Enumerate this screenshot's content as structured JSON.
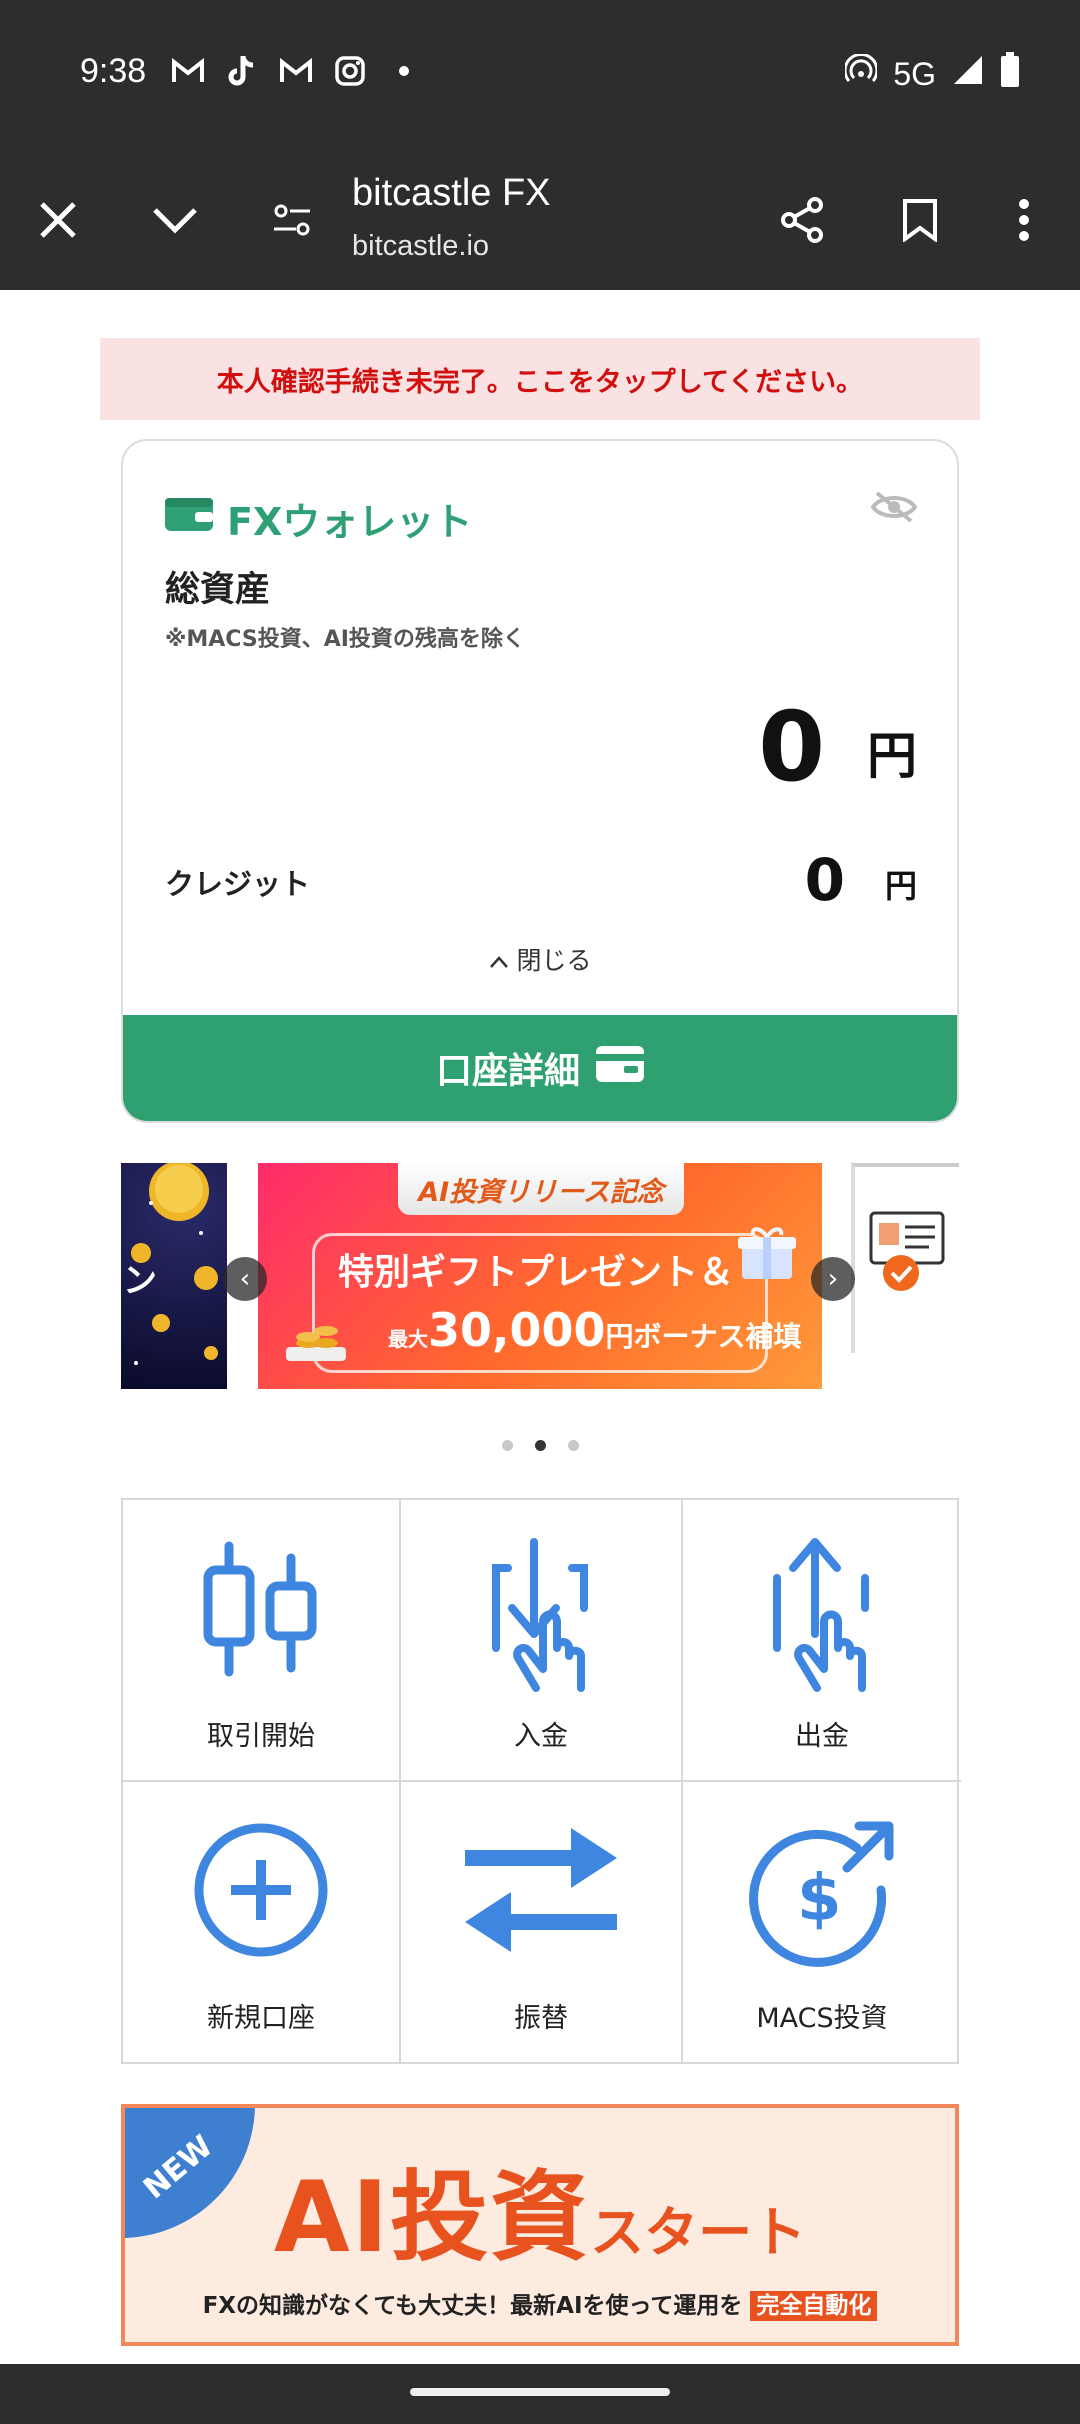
{
  "status_bar": {
    "time": "9:38",
    "network": "5G"
  },
  "browser": {
    "title": "bitcastle FX",
    "url": "bitcastle.io"
  },
  "alert": {
    "text": "本人確認手続き未完了。ここをタップしてください。"
  },
  "wallet": {
    "heading": "FXウォレット",
    "total_label": "総資産",
    "note": "※MACS投資、AI投資の残高を除く",
    "total_amount": "0",
    "currency": "円",
    "credit_label": "クレジット",
    "credit_amount": "0",
    "close_label": "閉じる",
    "detail_button": "口座詳細"
  },
  "carousel": {
    "slide_top": "AI投資リリース記念",
    "slide_line1": "特別ギフトプレゼント＆",
    "slide_line2_prefix": "最大",
    "slide_amount": "30,000",
    "slide_line2_suffix": "円ボーナス補填",
    "left_slide_text": "ン",
    "dots": 3,
    "active_dot": 1
  },
  "menu": {
    "items": [
      {
        "label": "取引開始",
        "icon": "candlestick-icon"
      },
      {
        "label": "入金",
        "icon": "deposit-icon"
      },
      {
        "label": "出金",
        "icon": "withdraw-icon"
      },
      {
        "label": "新規口座",
        "icon": "plus-circle-icon"
      },
      {
        "label": "振替",
        "icon": "transfer-icon"
      },
      {
        "label": "MACS投資",
        "icon": "dollar-investment-icon"
      }
    ]
  },
  "ai_banner": {
    "tag": "NEW",
    "title_big": "AI投資",
    "title_small": "スタート",
    "subtitle": "FXの知識がなくても大丈夫！最新AIを使って運用を",
    "highlight": "完全自動化"
  },
  "colors": {
    "accent_green": "#2fa070",
    "icon_blue": "#3f86e0",
    "alert_red": "#d10f0f",
    "orange": "#e8521e"
  }
}
